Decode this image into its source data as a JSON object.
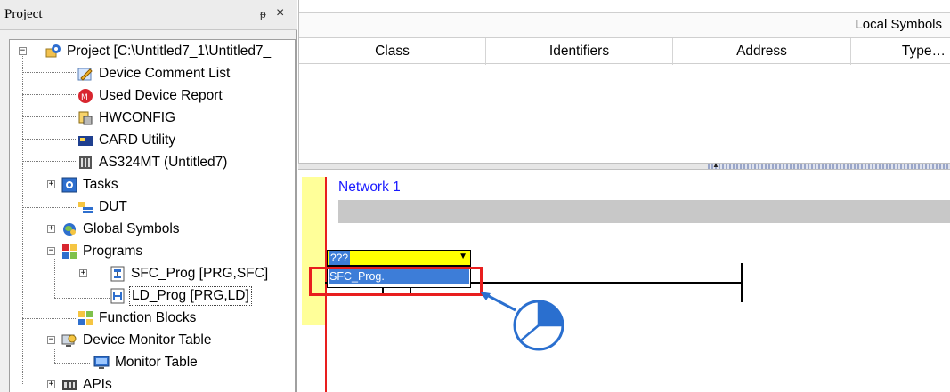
{
  "project_panel": {
    "title": "Project",
    "pin_glyph": "ᵽ",
    "close_glyph": "×",
    "tree": [
      {
        "label": "Project [C:\\Untitled7_1\\Untitled7_",
        "icon": "project-gear-icon"
      },
      {
        "label": "Device Comment List",
        "icon": "pencil-icon"
      },
      {
        "label": "Used Device Report",
        "icon": "report-badge-icon"
      },
      {
        "label": "HWCONFIG",
        "icon": "hwconfig-icon"
      },
      {
        "label": "CARD Utility",
        "icon": "card-icon"
      },
      {
        "label": "AS324MT  (Untitled7)",
        "icon": "plc-icon"
      },
      {
        "label": "Tasks",
        "icon": "tasks-icon"
      },
      {
        "label": "DUT",
        "icon": "dut-icon"
      },
      {
        "label": "Global Symbols",
        "icon": "global-symbols-icon"
      },
      {
        "label": "Programs",
        "icon": "programs-icon"
      },
      {
        "label": "SFC_Prog [PRG,SFC]",
        "icon": "sfc-icon"
      },
      {
        "label": "LD_Prog [PRG,LD]",
        "icon": "ld-icon"
      },
      {
        "label": "Function Blocks",
        "icon": "function-blocks-icon"
      },
      {
        "label": "Device Monitor Table",
        "icon": "monitor-table-icon"
      },
      {
        "label": "Monitor Table",
        "icon": "monitor-icon"
      },
      {
        "label": "APIs",
        "icon": "apis-icon"
      }
    ],
    "expander_plus": "+",
    "expander_minus": "−"
  },
  "symbols": {
    "title": "Local Symbols",
    "columns": [
      "Class",
      "Identifiers",
      "Address",
      "Type…"
    ]
  },
  "ladder": {
    "network_title": "Network 1",
    "combo_value": "???",
    "combo_arrow": "▼",
    "dropdown_option": "SFC_Prog."
  },
  "colors": {
    "highlight_red": "#e81e1e",
    "selection_blue": "#3d7dd8",
    "combo_yellow": "#ffff00",
    "rail_yellow": "#ffff99",
    "network_blue": "#1a1aff"
  }
}
